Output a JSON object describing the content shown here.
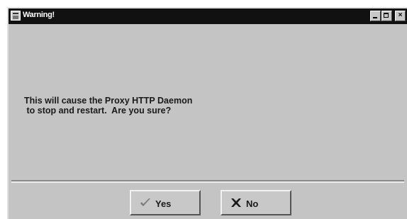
{
  "dialog": {
    "title": "Warning!",
    "message_line1": "This will cause the Proxy HTTP Daemon",
    "message_line2": " to stop and restart.  Are you sure?",
    "buttons": {
      "yes_label": "Yes",
      "yes_icon": "checkmark-icon",
      "no_label": "No",
      "no_icon": "x-icon"
    }
  },
  "titlebar": {
    "icon": "window-icon",
    "controls": [
      "minimize",
      "maximize",
      "close"
    ]
  },
  "colors": {
    "titlebar": "#111111",
    "window_bg": "#c4c4c4",
    "text": "#1a1a1a"
  }
}
